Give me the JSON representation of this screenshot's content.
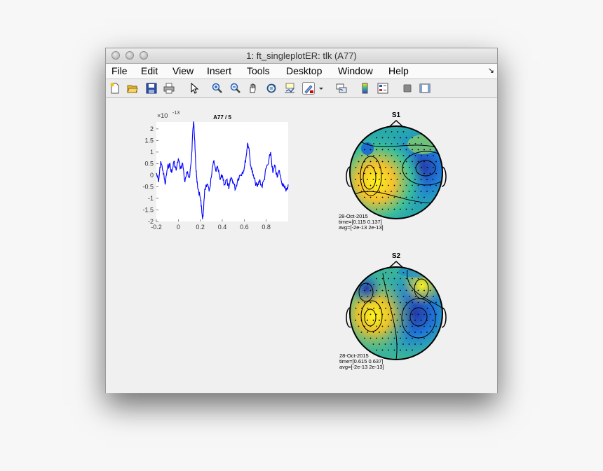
{
  "window": {
    "title": "1: ft_singleplotER: tlk (A77)"
  },
  "menu": [
    "File",
    "Edit",
    "View",
    "Insert",
    "Tools",
    "Desktop",
    "Window",
    "Help"
  ],
  "menu_corner_glyph": "↘",
  "toolbar_icons": [
    "new-figure-icon",
    "open-folder-icon",
    "save-icon",
    "print-icon",
    "pointer-icon",
    "zoom-in-icon",
    "zoom-out-icon",
    "pan-hand-icon",
    "rotate-3d-icon",
    "data-cursor-icon",
    "brush-icon",
    "brush-dropdown-icon",
    "link-plot-icon",
    "colorbar-icon",
    "legend-icon",
    "hide-plot-tools-icon",
    "show-plot-tools-icon"
  ],
  "plot": {
    "title": "A77 / 5",
    "exponent_label": "×10",
    "exponent_power": "-13",
    "xticks": [
      "-0.2",
      "0",
      "0.2",
      "0.4",
      "0.6",
      "0.8"
    ],
    "yticks": [
      "2",
      "1.5",
      "1",
      "0.5",
      "0",
      "-0.5",
      "-1",
      "-1.5",
      "-2"
    ],
    "line_color": "#0000ff"
  },
  "topo1": {
    "label": "S1",
    "info": [
      "28-Oct-2015",
      "time=[0.115 0.137]",
      "avg=[-2e-13 2e-13]"
    ]
  },
  "topo2": {
    "label": "S2",
    "info": [
      "28-Oct-2015",
      "time=[0.615 0.637]",
      "avg=[-2e-13 2e-13]"
    ]
  },
  "chart_data": {
    "type": "line",
    "title": "A77 / 5",
    "xlabel": "",
    "ylabel": "",
    "xlim": [
      -0.2,
      1.0
    ],
    "ylim": [
      -2.0,
      2.3
    ],
    "y_scale_note": "×10^-13",
    "series": [
      {
        "x": [
          -0.2,
          -0.18,
          -0.16,
          -0.14,
          -0.12,
          -0.1,
          -0.08,
          -0.06,
          -0.04,
          -0.02,
          0,
          0.02,
          0.04,
          0.06,
          0.08,
          0.1,
          0.12,
          0.13,
          0.14,
          0.15,
          0.16,
          0.17,
          0.18,
          0.2,
          0.21,
          0.22,
          0.23,
          0.24,
          0.26,
          0.28,
          0.3,
          0.32,
          0.34,
          0.36,
          0.38,
          0.4,
          0.42,
          0.44,
          0.46,
          0.48,
          0.5,
          0.52,
          0.54,
          0.56,
          0.58,
          0.6,
          0.62,
          0.63,
          0.64,
          0.66,
          0.68,
          0.7,
          0.72,
          0.74,
          0.76,
          0.78,
          0.8,
          0.82,
          0.84,
          0.86,
          0.88,
          0.9,
          0.92,
          0.94,
          0.96,
          0.98,
          1.0
        ],
        "y": [
          0.1,
          -0.3,
          0.6,
          0.2,
          -0.4,
          0.3,
          0.5,
          0.1,
          0.6,
          0.2,
          0.7,
          0.3,
          0.5,
          -0.3,
          0.1,
          -0.1,
          0.7,
          1.8,
          2.3,
          1.5,
          0.3,
          -0.3,
          -0.6,
          -1.0,
          -1.3,
          -1.9,
          -1.5,
          -0.6,
          -0.4,
          -0.7,
          -0.1,
          0.6,
          0.2,
          0.3,
          -0.2,
          0.0,
          -0.4,
          -0.2,
          -0.6,
          -0.1,
          -0.3,
          -0.6,
          -0.2,
          0.0,
          0.1,
          0.3,
          0.9,
          1.4,
          1.2,
          0.4,
          0.0,
          -0.3,
          -0.5,
          -0.2,
          -0.5,
          -0.2,
          0.3,
          0.5,
          1.0,
          0.1,
          0.4,
          -0.1,
          0.2,
          -0.3,
          -0.4,
          -0.7,
          -0.4
        ]
      }
    ]
  }
}
